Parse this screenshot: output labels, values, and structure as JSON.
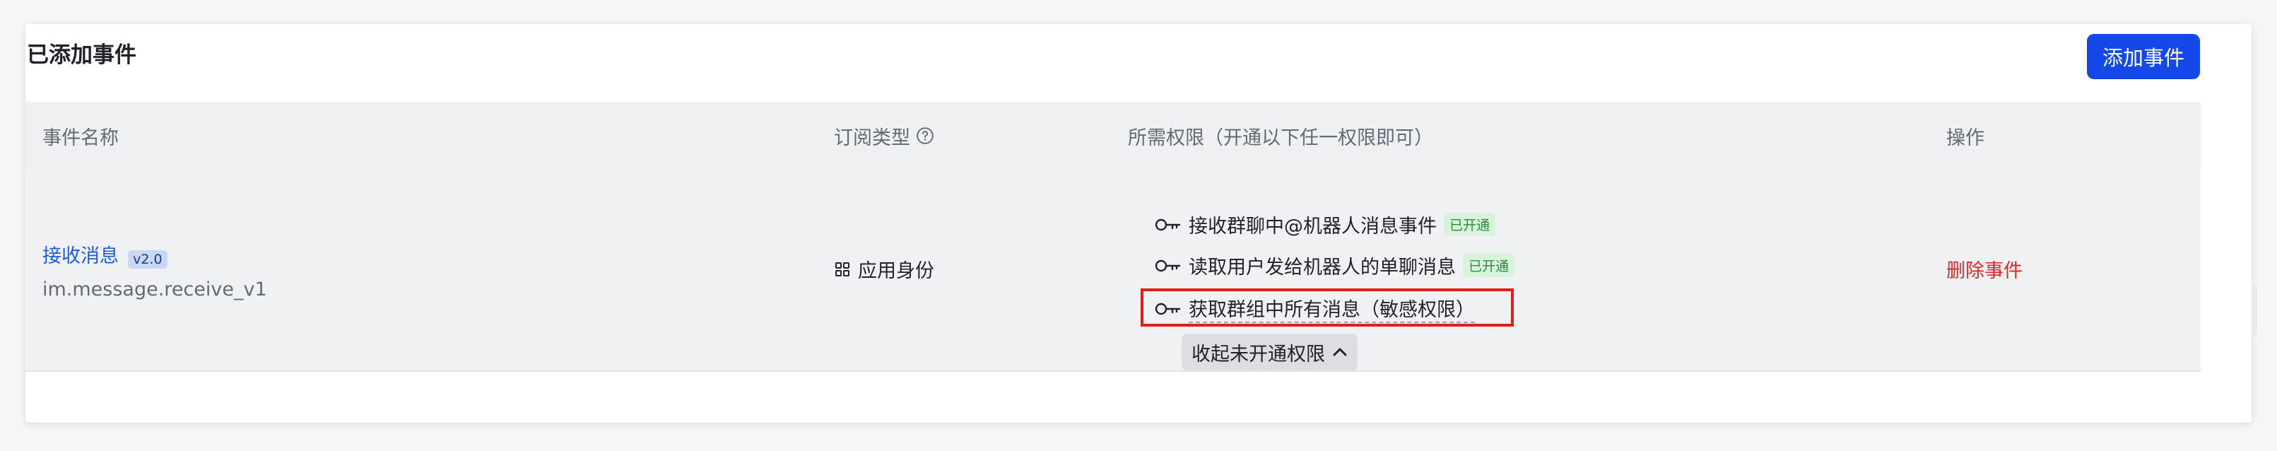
{
  "card": {
    "title": "已添加事件",
    "add_button_label": "添加事件"
  },
  "table": {
    "headers": {
      "event_name": "事件名称",
      "subscription_type": "订阅类型",
      "permissions": "所需权限（开通以下任一权限即可）",
      "actions": "操作"
    },
    "row": {
      "event_name": "接收消息",
      "version": "v2.0",
      "event_key": "im.message.receive_v1",
      "subscription_type": "应用身份",
      "permissions": [
        {
          "label": "接收群聊中@机器人消息事件",
          "status": "已开通"
        },
        {
          "label": "读取用户发给机器人的单聊消息",
          "status": "已开通"
        },
        {
          "label": "获取群组中所有消息（敏感权限）",
          "status": ""
        }
      ],
      "collapse_label": "收起未开通权限",
      "delete_label": "删除事件"
    }
  },
  "colors": {
    "primary": "#1548e8",
    "link": "#1d5ce0",
    "danger": "#e02828",
    "highlight": "#e01e1e",
    "tag_green_bg": "#d9f2dc",
    "tag_green_text": "#2c8a3b"
  },
  "icons": {
    "help": "question-circle-icon",
    "app_identity": "grid-icon",
    "permission": "key-icon",
    "collapse": "chevron-up-icon"
  }
}
